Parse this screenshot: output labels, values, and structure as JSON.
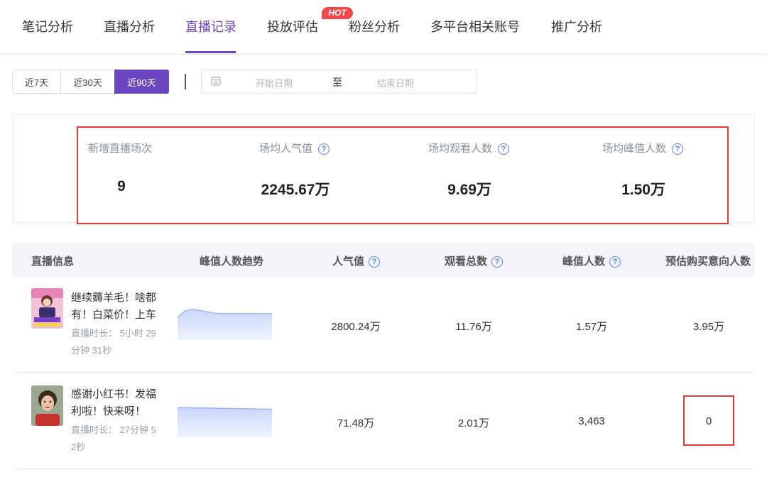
{
  "tabs": [
    {
      "label": "笔记分析",
      "active": false
    },
    {
      "label": "直播分析",
      "active": false
    },
    {
      "label": "直播记录",
      "active": true
    },
    {
      "label": "投放评估",
      "active": false
    },
    {
      "label": "粉丝分析",
      "active": false,
      "badge": "HOT"
    },
    {
      "label": "多平台相关账号",
      "active": false
    },
    {
      "label": "推广分析",
      "active": false
    }
  ],
  "filters": {
    "ranges": [
      {
        "label": "近7天",
        "active": false
      },
      {
        "label": "近30天",
        "active": false
      },
      {
        "label": "近90天",
        "active": true
      }
    ],
    "date": {
      "start_placeholder": "开始日期",
      "separator": "至",
      "end_placeholder": "结束日期"
    }
  },
  "stats": [
    {
      "label": "新增直播场次",
      "value": "9",
      "help": false
    },
    {
      "label": "场均人气值",
      "value": "2245.67万",
      "help": true
    },
    {
      "label": "场均观看人数",
      "value": "9.69万",
      "help": true
    },
    {
      "label": "场均峰值人数",
      "value": "1.50万",
      "help": true
    }
  ],
  "table": {
    "headers": [
      "直播信息",
      "峰值人数趋势",
      "人气值",
      "观看总数",
      "峰值人数",
      "预估购买意向人数"
    ],
    "rows": [
      {
        "title_lines": [
          "继续薅羊毛！啥都",
          "有！白菜价！上车"
        ],
        "duration_lines": [
          "直播时长： 5小时 29",
          "分钟 31秒"
        ],
        "popularity": "2800.24万",
        "views": "11.76万",
        "peak": "1.57万",
        "buyers": "3.95万",
        "trend": [
          0.62,
          0.8,
          0.85,
          0.82,
          0.78,
          0.74,
          0.73,
          0.73,
          0.73,
          0.73,
          0.73,
          0.73,
          0.73,
          0.73
        ]
      },
      {
        "title_lines": [
          "感谢小红书！发福",
          "利啦！快来呀！"
        ],
        "duration_lines": [
          "直播时长： 27分钟 5",
          "2秒"
        ],
        "popularity": "71.48万",
        "views": "2.01万",
        "peak": "3,463",
        "buyers": "0",
        "trend": [
          0.82,
          0.815,
          0.81,
          0.805,
          0.8,
          0.795,
          0.79,
          0.785,
          0.78,
          0.775
        ]
      }
    ]
  },
  "colors": {
    "accent": "#6b46c1",
    "highlight_box": "#e03c3c",
    "help_icon": "#5b7ef0",
    "trend_line": "#9db4f3"
  }
}
